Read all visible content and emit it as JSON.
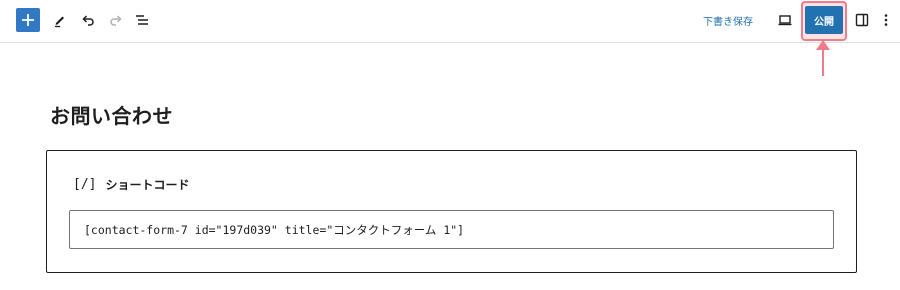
{
  "toolbar": {
    "add_icon": "plus-icon",
    "tools_icon": "pencil-icon",
    "undo_icon": "undo-icon",
    "redo_icon": "redo-icon",
    "list_view_icon": "list-view-icon",
    "save_draft_label": "下書き保存",
    "preview_icon": "desktop-preview-icon",
    "publish_label": "公開",
    "settings_icon": "sidebar-panel-icon",
    "options_icon": "vertical-ellipsis-icon",
    "accent_color": "#2271b1",
    "highlight_color": "#f07c8a"
  },
  "page": {
    "title": "お問い合わせ"
  },
  "shortcode_block": {
    "icon_glyph": "[/]",
    "label": "ショートコード",
    "value": "[contact-form-7 id=\"197d039\" title=\"コンタクトフォーム 1\"]"
  }
}
